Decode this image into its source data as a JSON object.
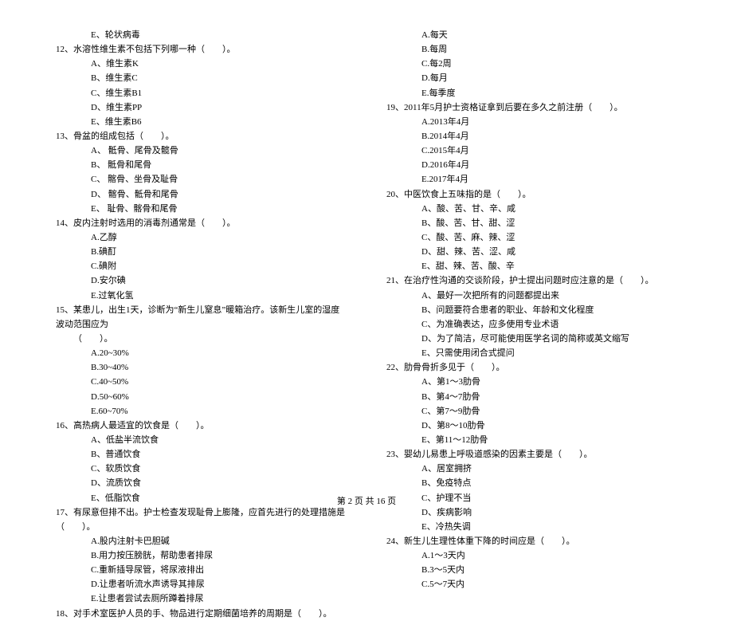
{
  "left": {
    "q11_tail": {
      "e": "E、轮状病毒"
    },
    "q12": {
      "stem": "12、水溶性维生素不包括下列哪一种（　　）。",
      "a": "A、维生素K",
      "b": "B、维生素C",
      "c": "C、维生素B1",
      "d": "D、维生素PP",
      "e": "E、维生素B6"
    },
    "q13": {
      "stem": "13、骨盆的组成包括（　　）。",
      "a": "A、 骶骨、尾骨及髋骨",
      "b": "B、 骶骨和尾骨",
      "c": "C、 髂骨、坐骨及耻骨",
      "d": "D、 髂骨、骶骨和尾骨",
      "e": "E、 耻骨、髂骨和尾骨"
    },
    "q14": {
      "stem": "14、皮内注射时选用的消毒剂通常是（　　）。",
      "a": "A.乙醇",
      "b": "B.碘酊",
      "c": "C.碘附",
      "d": "D.安尔碘",
      "e": "E.过氧化氢"
    },
    "q15": {
      "stem1": "15、某患儿，出生1天，诊断为“新生儿窒息”暖箱治疗。该新生儿室的湿度波动范围应为",
      "stem2": "（　　）。",
      "a": "A.20~30%",
      "b": "B.30~40%",
      "c": "C.40~50%",
      "d": "D.50~60%",
      "e": "E.60~70%"
    },
    "q16": {
      "stem": "16、高热病人最适宜的饮食是（　　）。",
      "a": "A、低盐半流饮食",
      "b": "B、普通饮食",
      "c": "C、软质饮食",
      "d": "D、流质饮食",
      "e": "E、低脂饮食"
    },
    "q17": {
      "stem": "17、有尿意但排不出。护士检查发现耻骨上膨隆，应首先进行的处理措施是（　　）。",
      "a": "A.股内注射卡巴胆碱",
      "b": "B.用力按压膀胱，帮助患者排尿",
      "c": "C.重新插导尿管，将尿液排出",
      "d": "D.让患者听流水声诱导其排尿",
      "e": "E.让患者尝试去厕所蹲着排尿"
    },
    "q18": {
      "stem": "18、对手术室医护人员的手、物品进行定期细菌培养的周期是（　　）。"
    }
  },
  "right": {
    "q18_opts": {
      "a": "A.每天",
      "b": "B.每周",
      "c": "C.每2周",
      "d": "D.每月",
      "e": "E.每季度"
    },
    "q19": {
      "stem": "19、2011年5月护士资格证拿到后要在多久之前注册（　　）。",
      "a": "A.2013年4月",
      "b": "B.2014年4月",
      "c": "C.2015年4月",
      "d": "D.2016年4月",
      "e": "E.2017年4月"
    },
    "q20": {
      "stem": "20、中医饮食上五味指的是（　　）。",
      "a": "A、酸、苦、甘、辛、咸",
      "b": "B、酸、苦、甘、甜、涩",
      "c": "C、酸、苦、麻、辣、涩",
      "d": "D、甜、辣、苦、涩、咸",
      "e": "E、甜、辣、苦、酸、辛"
    },
    "q21": {
      "stem": "21、在治疗性沟通的交谈阶段，护士提出问题时应注意的是（　　）。",
      "a": "A、最好一次把所有的问题都提出来",
      "b": "B、问题要符合患者的职业、年龄和文化程度",
      "c": "C、为准确表达，应多使用专业术语",
      "d": "D、为了简洁，尽可能使用医学名词的简称或英文缩写",
      "e": "E、只需使用闭合式提问"
    },
    "q22": {
      "stem": "22、肋骨骨折多见于（　　）。",
      "a": "A、第1～3肋骨",
      "b": "B、第4～7肋骨",
      "c": "C、第7～9肋骨",
      "d": "D、第8～10肋骨",
      "e": "E、第11～12肋骨"
    },
    "q23": {
      "stem": "23、婴幼儿易患上呼吸道感染的因素主要是（　　）。",
      "a": "A、居室拥挤",
      "b": "B、免疫特点",
      "c": "C、护理不当",
      "d": "D、疾病影响",
      "e": "E、冷热失调"
    },
    "q24": {
      "stem": "24、新生儿生理性体重下降的时间应是（　　）。",
      "a": "A.1～3天内",
      "b": "B.3～5天内",
      "c": "C.5～7天内"
    }
  },
  "footer": "第 2 页 共 16 页"
}
